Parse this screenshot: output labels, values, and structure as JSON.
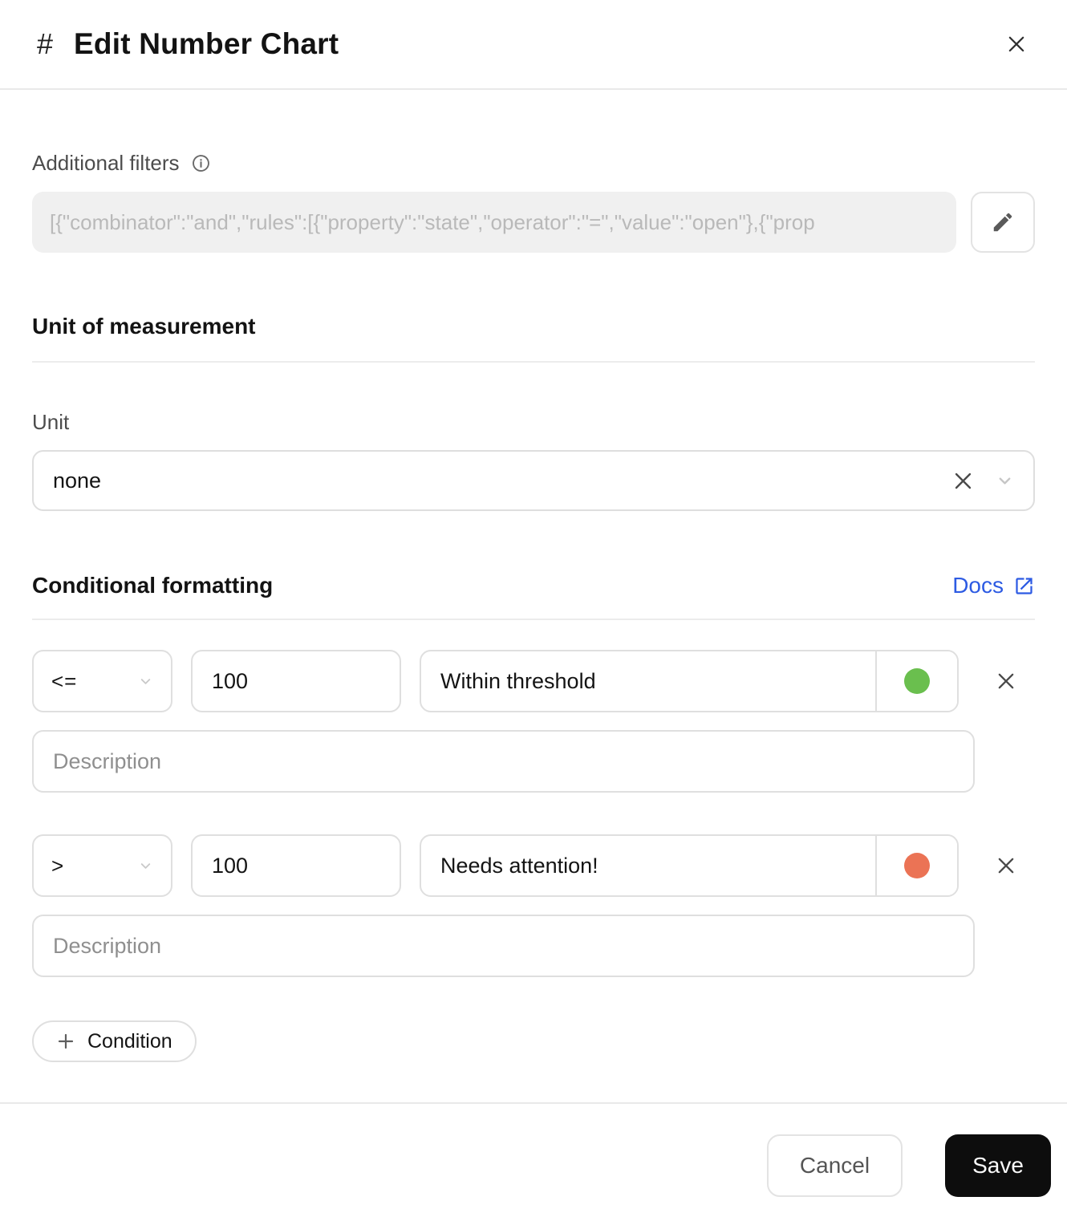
{
  "header": {
    "hash_icon": "#",
    "title": "Edit Number Chart"
  },
  "filters": {
    "label": "Additional filters",
    "value": "[{\"combinator\":\"and\",\"rules\":[{\"property\":\"state\",\"operator\":\"=\",\"value\":\"open\"},{\"prop"
  },
  "unit_section": {
    "heading": "Unit of measurement",
    "unit_label": "Unit",
    "unit_value": "none"
  },
  "conditional": {
    "heading": "Conditional formatting",
    "docs_label": "Docs",
    "add_condition_label": "Condition",
    "conditions": [
      {
        "operator": "<=",
        "value": "100",
        "label": "Within threshold",
        "color": "#6abf4e",
        "description_placeholder": "Description"
      },
      {
        "operator": ">",
        "value": "100",
        "label": "Needs attention!",
        "color": "#eb7355",
        "description_placeholder": "Description"
      }
    ]
  },
  "footer": {
    "cancel_label": "Cancel",
    "save_label": "Save"
  },
  "colors": {
    "docs_link": "#2d5be3",
    "green_status": "#6abf4e",
    "orange_status": "#eb7355",
    "save_bg": "#0d0d0d"
  }
}
